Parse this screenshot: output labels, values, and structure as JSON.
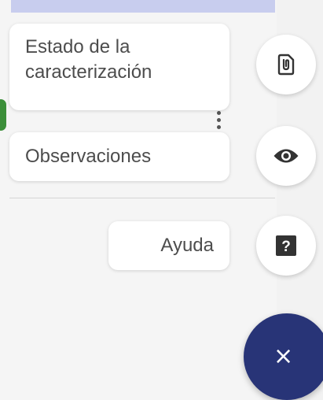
{
  "menu": {
    "actions": [
      {
        "id": "estado",
        "label_lines": [
          "Estado de la",
          "caracterización"
        ],
        "icon": "paperclip-document-icon"
      },
      {
        "id": "observaciones",
        "label": "Observaciones",
        "icon": "eye-icon"
      },
      {
        "id": "ayuda",
        "label": "Ayuda",
        "icon": "help-icon",
        "icon_text": "?"
      }
    ],
    "close_button": {
      "icon": "close-icon",
      "symbol": "×"
    }
  },
  "colors": {
    "fab_main": "#283477",
    "icon": "#333333",
    "label_text": "#4d4d4d",
    "top_bar": "#c8cdee",
    "green_indicator": "#3c8f3a"
  }
}
